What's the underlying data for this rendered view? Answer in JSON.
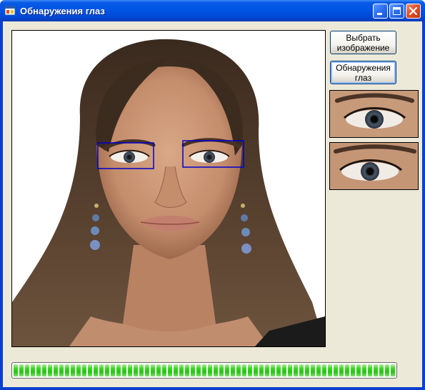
{
  "window": {
    "title": "Обнаружения глаз",
    "controls": [
      "minimize",
      "maximize",
      "close"
    ]
  },
  "buttons": {
    "select_image": "Выбрать изображение",
    "detect_eyes": "Обнаружения глаз"
  },
  "icons": {
    "app": "app-icon",
    "minimize": "minimize-icon",
    "maximize": "maximize-icon",
    "close": "close-icon"
  },
  "picture": {
    "detections": [
      "left-eye-detection-box",
      "right-eye-detection-box"
    ],
    "box_color": "#0000cc"
  },
  "progress": {
    "value_percent": 100,
    "color": "#2bc21a"
  },
  "colors": {
    "titlebar": "#0054e3",
    "client_background": "#ece9d8",
    "button_border": "#003c74"
  }
}
